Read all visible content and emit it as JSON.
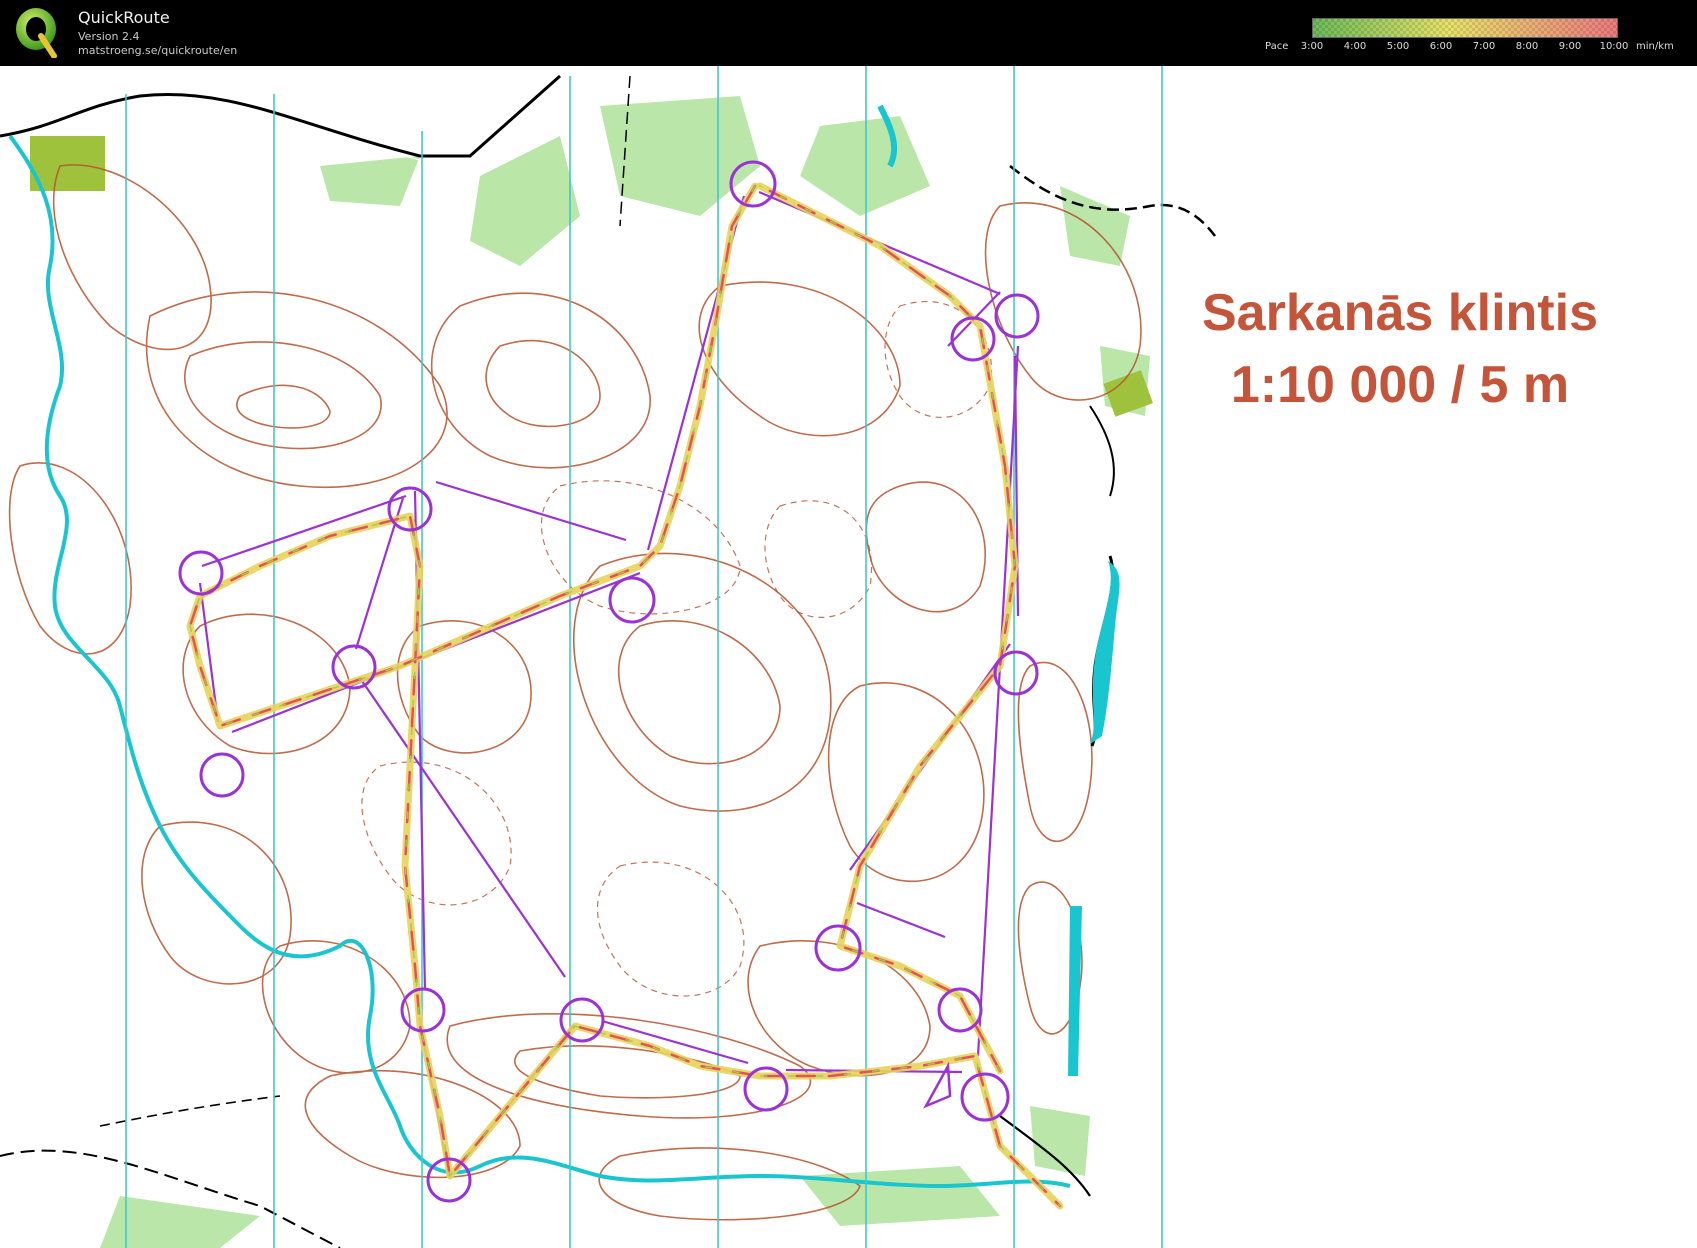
{
  "app": {
    "name": "QuickRoute",
    "version": "Version 2.4",
    "url": "matstroeng.se/quickroute/en",
    "logo_letter": "Q"
  },
  "pace_scale": {
    "label": "Pace",
    "ticks": [
      "3:00",
      "4:00",
      "5:00",
      "6:00",
      "7:00",
      "8:00",
      "9:00",
      "10:00"
    ],
    "unit": "min/km",
    "colors": [
      "#7ec66e",
      "#f3e66c",
      "#f08a7a"
    ]
  },
  "map": {
    "title_line1": "Sarkanās klintis",
    "title_line2": "1:10 000 / 5 m",
    "title_color": "#c4553a",
    "course_color": "#9b32d6",
    "route_colors": [
      "#e8d35a",
      "#e04c5c",
      "#a8c850"
    ],
    "meridian_color": "#3fc8d0",
    "water_color": "#19c6cf",
    "contour_color": "#b5522d",
    "vegetation_color": "#aee39a"
  }
}
